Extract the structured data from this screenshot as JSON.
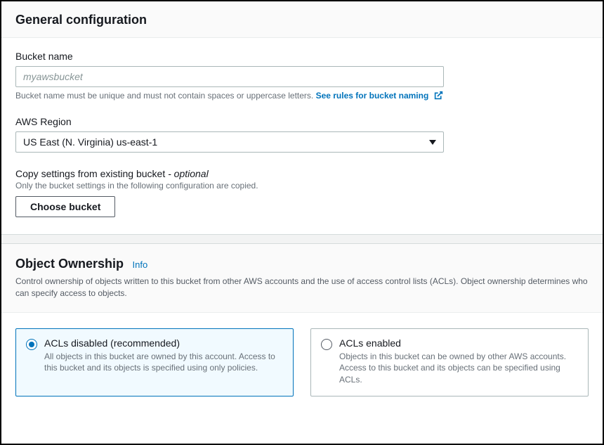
{
  "general": {
    "title": "General configuration",
    "bucketName": {
      "label": "Bucket name",
      "placeholder": "myawsbucket",
      "value": "",
      "hint": "Bucket name must be unique and must not contain spaces or uppercase letters. ",
      "rulesLink": "See rules for bucket naming"
    },
    "region": {
      "label": "AWS Region",
      "selected": "US East (N. Virginia) us-east-1"
    },
    "copySettings": {
      "label": "Copy settings from existing bucket",
      "optional": " - optional",
      "hint": "Only the bucket settings in the following configuration are copied.",
      "button": "Choose bucket"
    }
  },
  "ownership": {
    "title": "Object Ownership",
    "info": "Info",
    "desc": "Control ownership of objects written to this bucket from other AWS accounts and the use of access control lists (ACLs). Object ownership determines who can specify access to objects.",
    "options": [
      {
        "id": "acls-disabled",
        "title": "ACLs disabled (recommended)",
        "desc": "All objects in this bucket are owned by this account. Access to this bucket and its objects is specified using only policies.",
        "selected": true
      },
      {
        "id": "acls-enabled",
        "title": "ACLs enabled",
        "desc": "Objects in this bucket can be owned by other AWS accounts. Access to this bucket and its objects can be specified using ACLs.",
        "selected": false
      }
    ]
  }
}
